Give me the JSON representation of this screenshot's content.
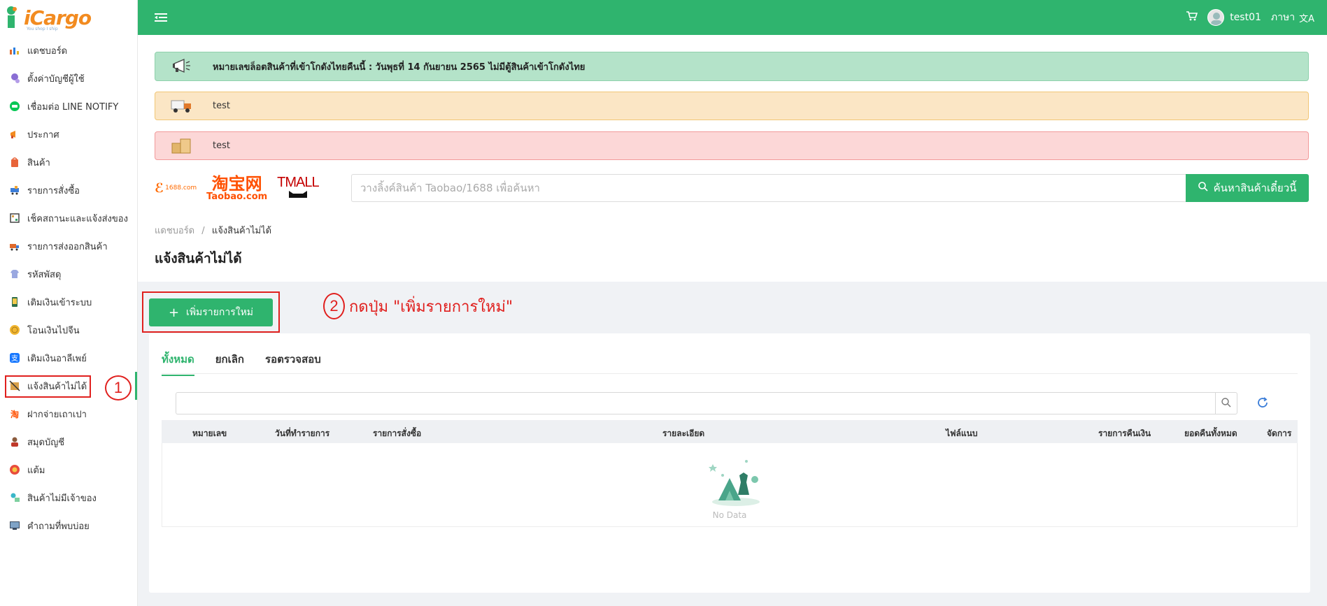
{
  "app": {
    "logo_text": "iCargo",
    "logo_tagline": "You shop I ship"
  },
  "sidebar": {
    "items": [
      {
        "label": "แดชบอร์ด"
      },
      {
        "label": "ตั้งค่าบัญชีผู้ใช้"
      },
      {
        "label": "เชื่อมต่อ LINE NOTIFY"
      },
      {
        "label": "ประกาศ"
      },
      {
        "label": "สินค้า"
      },
      {
        "label": "รายการสั่งซื้อ"
      },
      {
        "label": "เช็คสถานะและแจ้งส่งของ"
      },
      {
        "label": "รายการส่งออกสินค้า"
      },
      {
        "label": "รหัสพัสดุ"
      },
      {
        "label": "เติมเงินเข้าระบบ"
      },
      {
        "label": "โอนเงินไปจีน"
      },
      {
        "label": "เติมเงินอาลีเพย์"
      },
      {
        "label": "แจ้งสินค้าไม่ได้"
      },
      {
        "label": "ฝากจ่ายเถาเปา"
      },
      {
        "label": "สมุดบัญชี"
      },
      {
        "label": "แต้ม"
      },
      {
        "label": "สินค้าไม่มีเจ้าของ"
      },
      {
        "label": "คำถามที่พบบ่อย"
      }
    ],
    "active_index": 12
  },
  "header": {
    "username": "test01",
    "language_label": "ภาษา"
  },
  "notices": {
    "main": "หมายเลขล็อตสินค้าที่เข้าโกดังไทยคืนนี้ : วันพุธที่ 14 กันยายน 2565 ไม่มีตู้สินค้าเข้าโกดังไทย",
    "truck": "test",
    "box": "test"
  },
  "brands": {
    "alibaba": "1688.com",
    "taobao_cn": "淘宝网",
    "taobao": "Taobao.com",
    "tmall": "TMALL"
  },
  "search": {
    "placeholder": "วางลิ้งค์สินค้า Taobao/1688 เพื่อค้นหา",
    "button": "ค้นหาสินค้าเดี๋ยวนี้"
  },
  "breadcrumb": {
    "home": "แดชบอร์ด",
    "separator": "/",
    "current": "แจ้งสินค้าไม่ได้"
  },
  "page_title": "แจ้งสินค้าไม่ได้",
  "add_button": {
    "icon": "+",
    "label": "เพิ่มรายการใหม่"
  },
  "annotations": {
    "step1": "1",
    "step2": "2",
    "instruction": "กดปุ่ม \"เพิ่มรายการใหม่\""
  },
  "tabs": [
    {
      "label": "ทั้งหมด"
    },
    {
      "label": "ยกเลิก"
    },
    {
      "label": "รอตรวจสอบ"
    }
  ],
  "table": {
    "columns": [
      "หมายเลข",
      "วันที่ทำรายการ",
      "รายการสั่งซื้อ",
      "รายละเอียด",
      "ไฟล์แนบ",
      "รายการคืนเงิน",
      "ยอดคืนทั้งหมด",
      "จัดการ"
    ],
    "empty_text": "No Data"
  },
  "colors": {
    "primary": "#2fb46e",
    "annotation": "#e0201e"
  }
}
